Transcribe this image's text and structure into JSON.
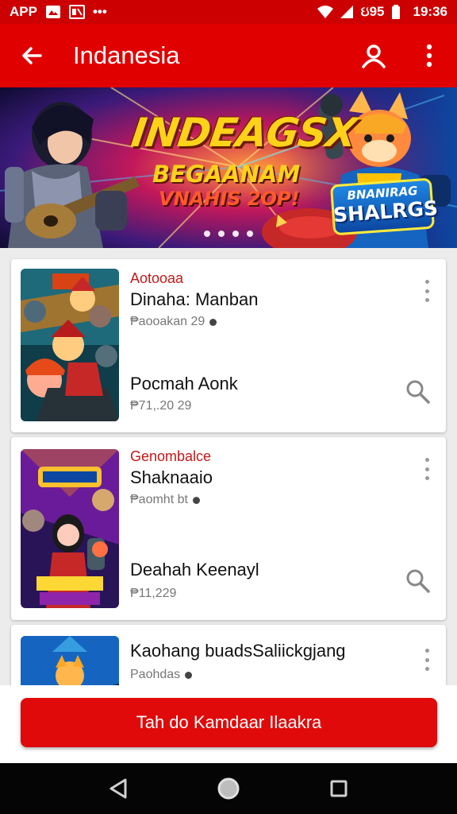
{
  "status_bar": {
    "carrier_label": "APP",
    "overflow_label": "•••",
    "signal_text": "ઇ95",
    "time": "19:36"
  },
  "app_bar": {
    "title": "Indanesia",
    "back_icon": "arrow-back-icon",
    "account_icon": "person-icon",
    "menu_icon": "more-vert-icon"
  },
  "banner": {
    "title": "INDEAGSX",
    "subtitle_line1": "BEGAANAM",
    "subtitle_line2": "VNAHIS 2OP!",
    "badge_line1": "BNANIRAG",
    "badge_line2": "SHALRGS",
    "dot_count": 4
  },
  "list": {
    "items": [
      {
        "category": "Aotooaa",
        "name": "Dinaha: Manban",
        "meta": "₱aooakan 29",
        "name2": "Pocmah Aonk",
        "meta2": "₱71,.20 29"
      },
      {
        "category": "Genombalce",
        "name": "Shaknaaio",
        "meta": "₱aomht bt",
        "name2": "Deahah Keenayl",
        "meta2": "₱11,229"
      },
      {
        "category": "",
        "name": "Kaohang buadsSaliickgjang",
        "meta": "Paohdas",
        "name2": "",
        "meta2": ""
      }
    ]
  },
  "cta": {
    "label": "Tah do Kamdaar Ilaakra"
  },
  "nav_bar": {
    "back_icon": "triangle-back-icon",
    "home_icon": "circle-home-icon",
    "recents_icon": "square-recents-icon"
  },
  "colors": {
    "primary": "#e00000",
    "status_bar": "#cc0000",
    "category_text": "#c41818",
    "background": "#ececec"
  }
}
